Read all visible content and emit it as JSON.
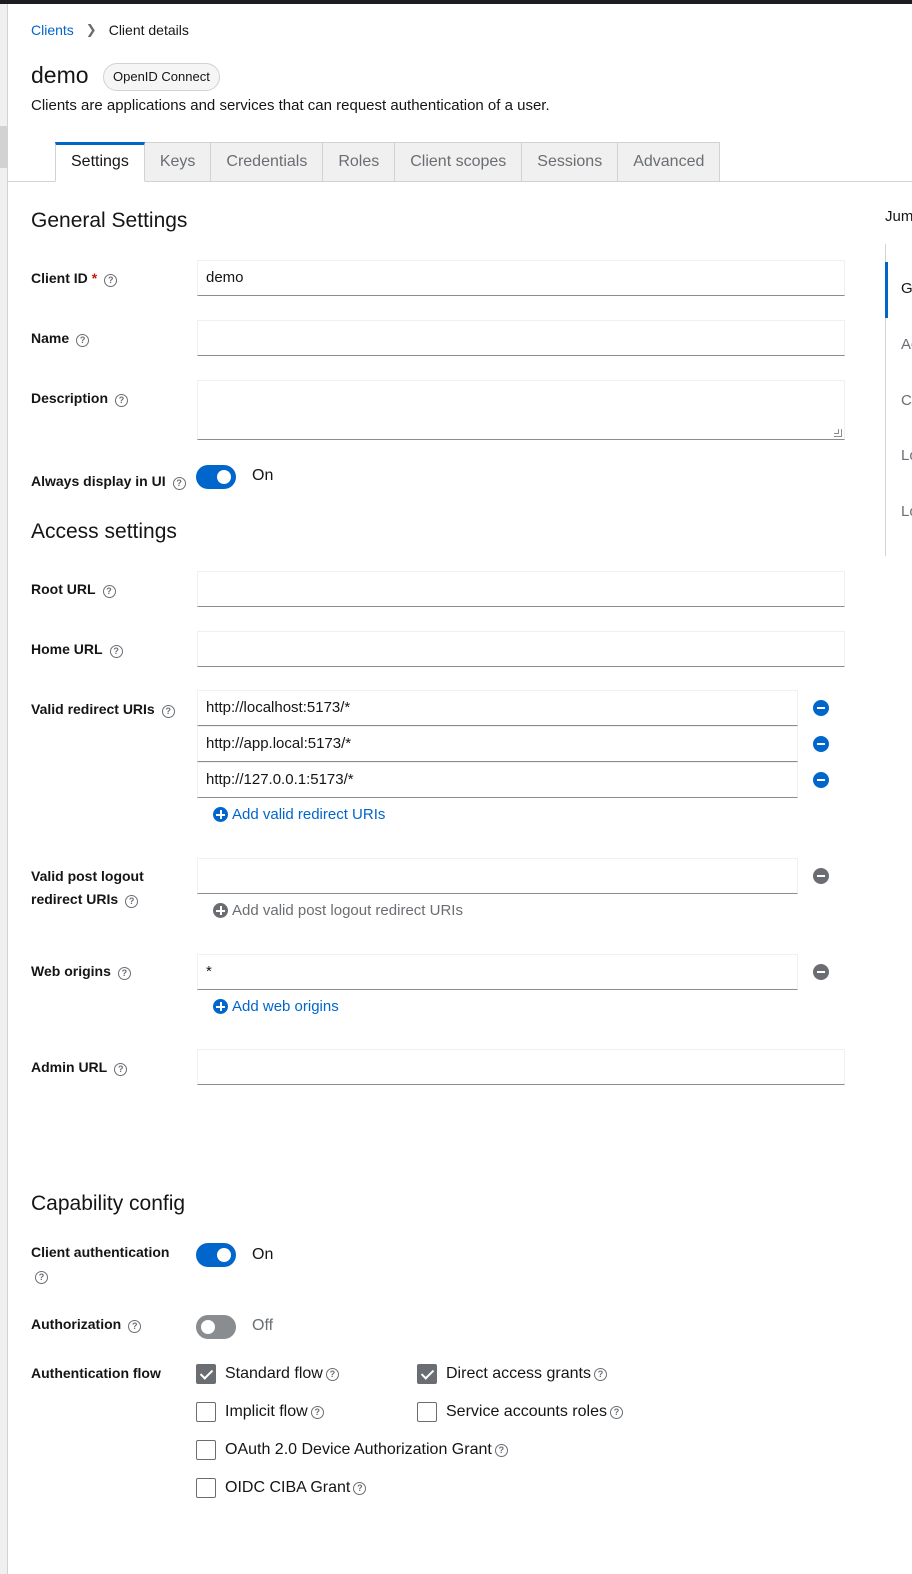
{
  "breadcrumb": {
    "parent": "Clients",
    "current": "Client details"
  },
  "header": {
    "title": "demo",
    "badge": "OpenID Connect",
    "subtitle": "Clients are applications and services that can request authentication of a user."
  },
  "tabs": [
    "Settings",
    "Keys",
    "Credentials",
    "Roles",
    "Client scopes",
    "Sessions",
    "Advanced"
  ],
  "active_tab": "Settings",
  "jump_to": {
    "title": "Jump to section",
    "items": [
      "General Settings",
      "Access settings",
      "Capability config",
      "Login settings",
      "Logout settings"
    ]
  },
  "general": {
    "heading": "General Settings",
    "client_id_label": "Client ID",
    "client_id_required": "*",
    "client_id_value": "demo",
    "name_label": "Name",
    "name_value": "",
    "description_label": "Description",
    "description_value": "",
    "always_display_label": "Always display in UI",
    "always_display_state": "On"
  },
  "access": {
    "heading": "Access settings",
    "root_url_label": "Root URL",
    "root_url_value": "",
    "home_url_label": "Home URL",
    "home_url_value": "",
    "redirect_label": "Valid redirect URIs",
    "redirect_uris": [
      "http://localhost:5173/*",
      "http://app.local:5173/*",
      "http://127.0.0.1:5173/*"
    ],
    "add_redirect": "Add valid redirect URIs",
    "post_logout_label_1": "Valid post logout",
    "post_logout_label_2": "redirect URIs",
    "post_logout_value": "",
    "add_post_logout": "Add valid post logout redirect URIs",
    "web_origins_label": "Web origins",
    "web_origins_value": "*",
    "add_web_origins": "Add web origins",
    "admin_url_label": "Admin URL",
    "admin_url_value": ""
  },
  "capability": {
    "heading": "Capability config",
    "client_auth_label": "Client authentication",
    "client_auth_state": "On",
    "authorization_label": "Authorization",
    "authorization_state": "Off",
    "auth_flow_label": "Authentication flow",
    "flows": {
      "standard": {
        "label": "Standard flow",
        "checked": true
      },
      "direct": {
        "label": "Direct access grants",
        "checked": true
      },
      "implicit": {
        "label": "Implicit flow",
        "checked": false
      },
      "service": {
        "label": "Service accounts roles",
        "checked": false
      },
      "device": {
        "label": "OAuth 2.0 Device Authorization Grant",
        "checked": false
      },
      "ciba": {
        "label": "OIDC CIBA Grant",
        "checked": false
      }
    }
  },
  "icons": {
    "help": "help-circle-icon",
    "remove": "minus-circle-icon",
    "add": "plus-circle-icon",
    "breadcrumb_separator": "chevron-right-icon"
  },
  "colors": {
    "accent": "#0066cc",
    "text": "#151515",
    "muted": "#6a6e73",
    "border": "#d2d2d2",
    "required": "#c9190b"
  }
}
